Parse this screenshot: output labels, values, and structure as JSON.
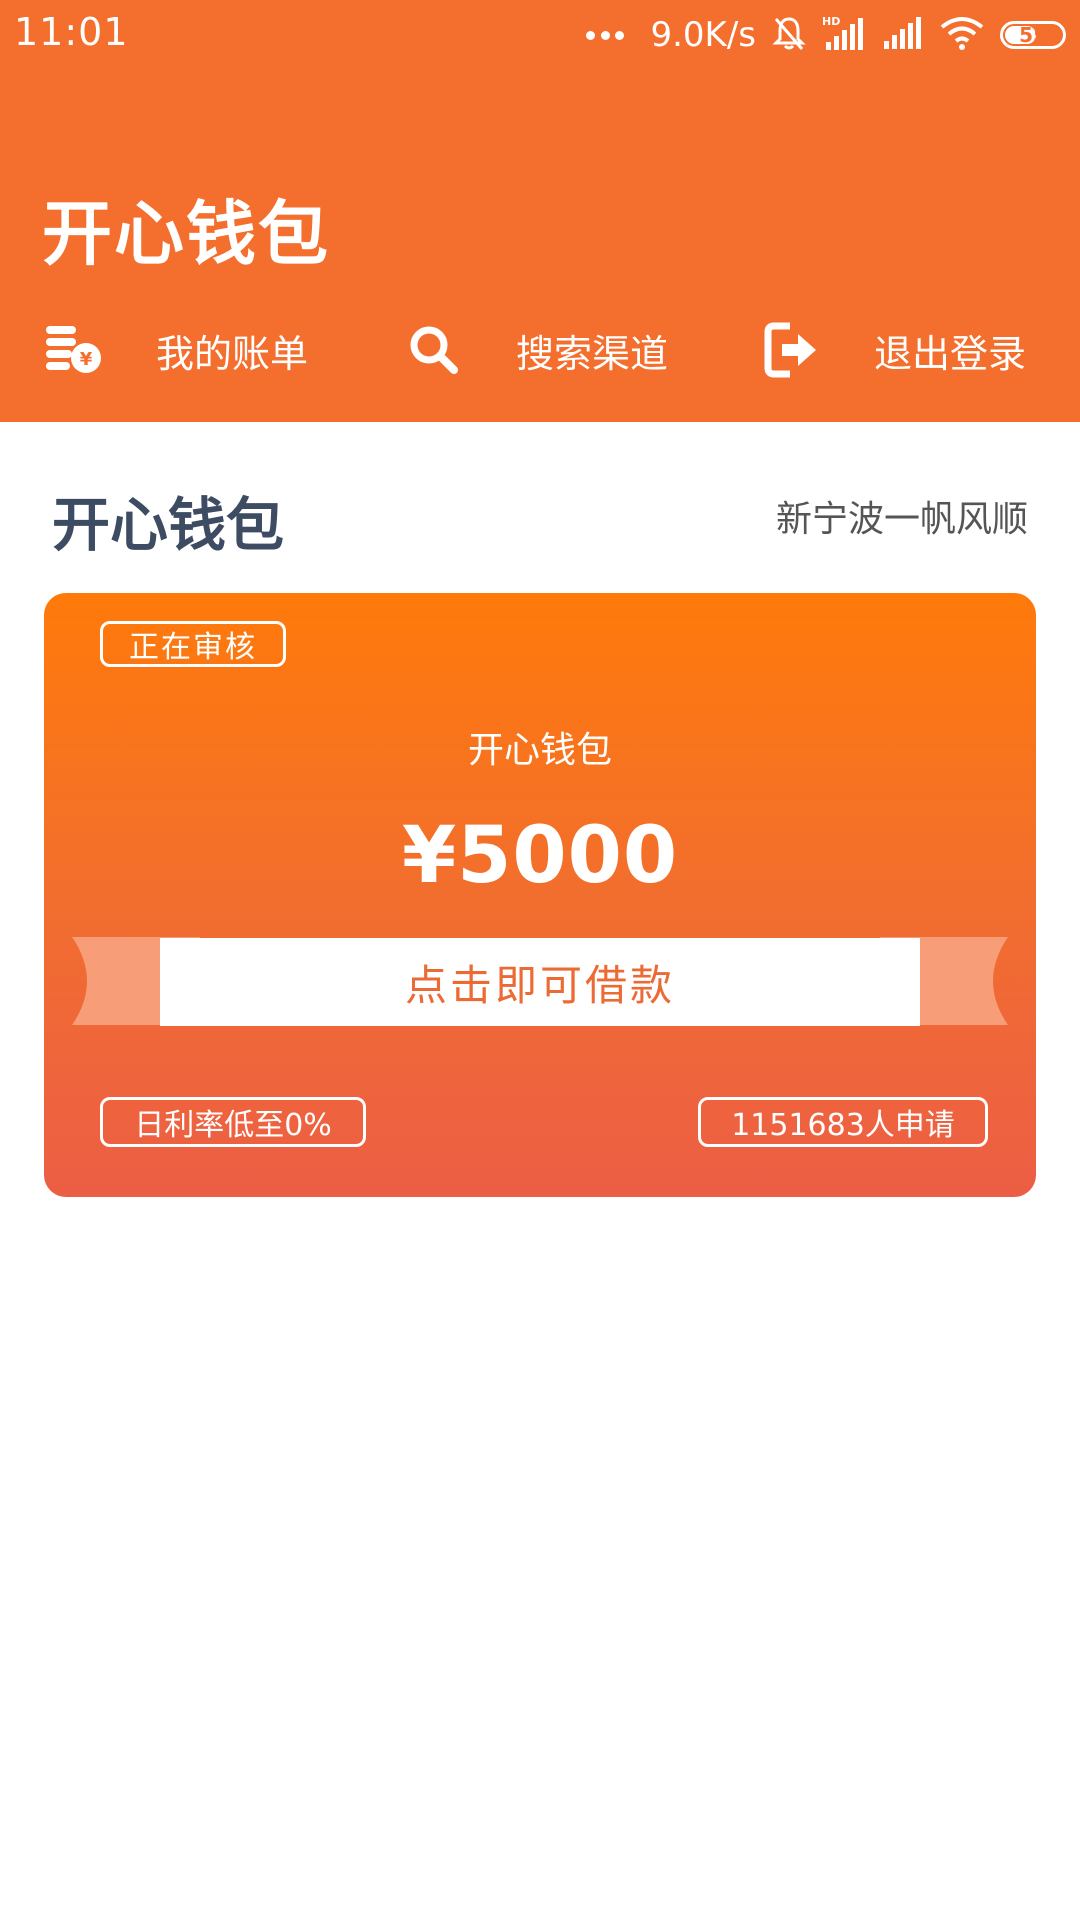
{
  "status_bar": {
    "time": "11:01",
    "net_speed": "9.0K/s",
    "battery_level": "55",
    "battery_fraction": 0.55
  },
  "header": {
    "title": "开心钱包",
    "nav": [
      {
        "label": "我的账单",
        "icon": "bill-coins-icon"
      },
      {
        "label": "搜索渠道",
        "icon": "search-icon"
      },
      {
        "label": "退出登录",
        "icon": "logout-icon"
      }
    ]
  },
  "section": {
    "title": "开心钱包",
    "subtitle": "新宁波一帆风顺"
  },
  "card": {
    "status": "正在审核",
    "name": "开心钱包",
    "amount": "¥5000",
    "button_label": "点击即可借款",
    "rate": "日利率低至0%",
    "applicants": "1151683人申请"
  },
  "colors": {
    "brand": "#F46F2D",
    "card_top": "#FF7A0A",
    "card_bottom": "#EC5E45",
    "title_text": "#3D4B63",
    "button_text": "#EC6A34"
  }
}
